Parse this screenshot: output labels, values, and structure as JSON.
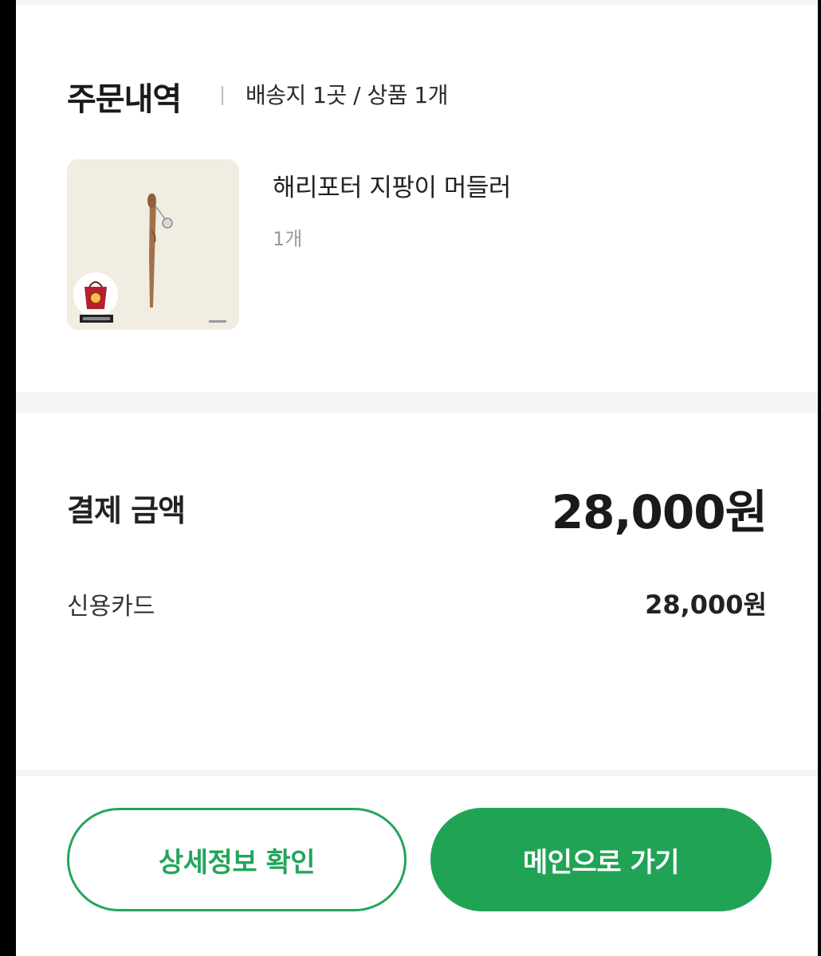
{
  "order": {
    "title": "주문내역",
    "summary": "배송지 1곳 / 상품 1개",
    "product": {
      "name": "해리포터 지팡이 머들러",
      "quantity": "1개",
      "image": "harry-potter-wand-muddler"
    }
  },
  "payment": {
    "label": "결제 금액",
    "total": "28,000원",
    "method_label": "신용카드",
    "method_amount": "28,000원"
  },
  "actions": {
    "details_label": "상세정보 확인",
    "main_label": "메인으로 가기"
  },
  "colors": {
    "accent": "#21a356",
    "divider_bg": "#f4f4f4"
  }
}
